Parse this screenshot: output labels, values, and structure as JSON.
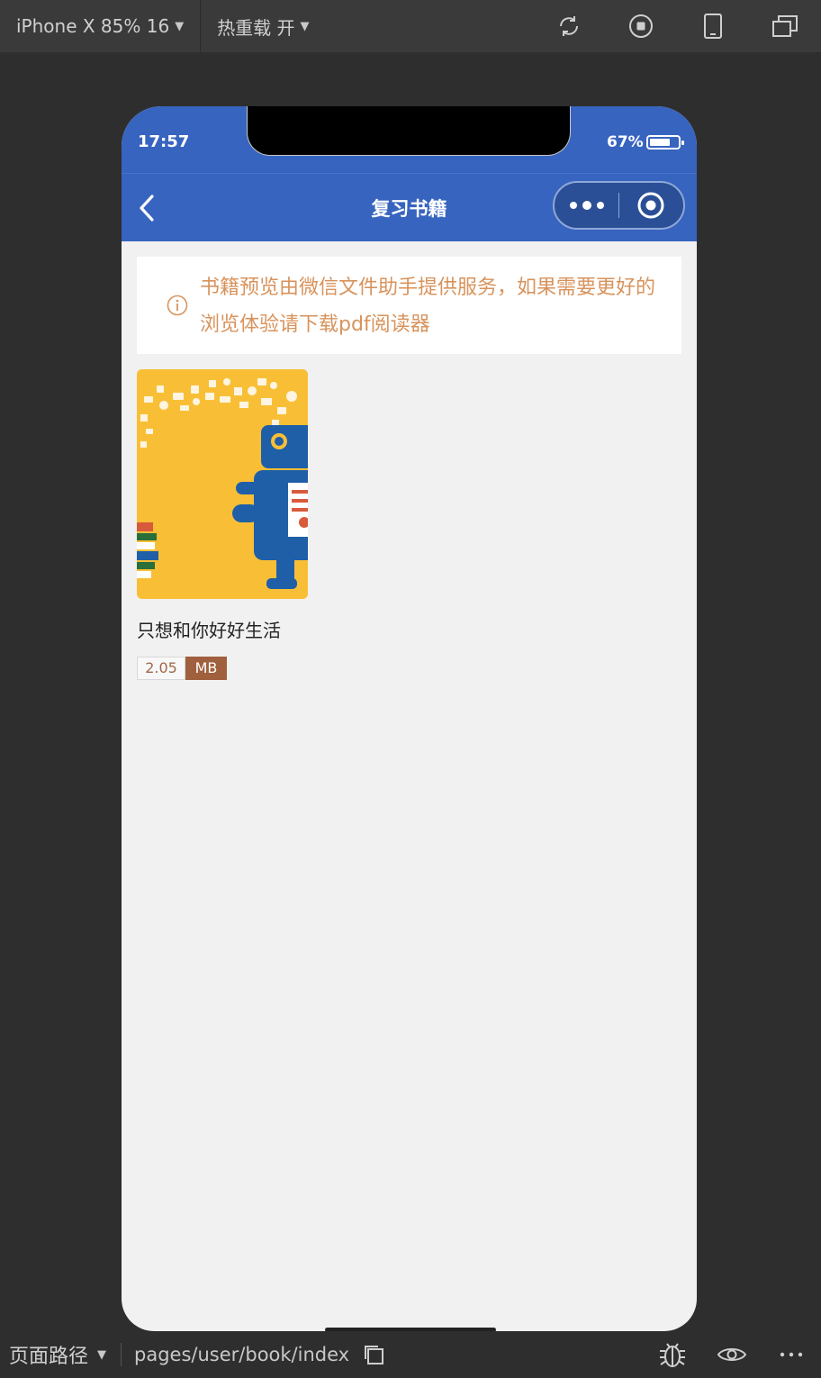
{
  "toolbar": {
    "device_label": "iPhone X 85% 16",
    "hot_reload_label": "热重载 开",
    "icons": [
      "refresh-icon",
      "stop-icon",
      "phone-icon",
      "window-icon"
    ]
  },
  "status_bar": {
    "time": "17:57",
    "battery_percent": "67%",
    "battery_level": 0.67
  },
  "nav_bar": {
    "title": "复习书籍",
    "color": "#3764bf"
  },
  "notice": {
    "text": "书籍预览由微信文件助手提供服务，如果需要更好的浏览体验请下载pdf阅读器",
    "color": "#d8935c"
  },
  "books": [
    {
      "title": "只想和你好好生活",
      "size_value": "2.05",
      "size_unit": "MB"
    }
  ],
  "bottom_bar": {
    "path_label": "页面路径",
    "path": "pages/user/book/index"
  }
}
